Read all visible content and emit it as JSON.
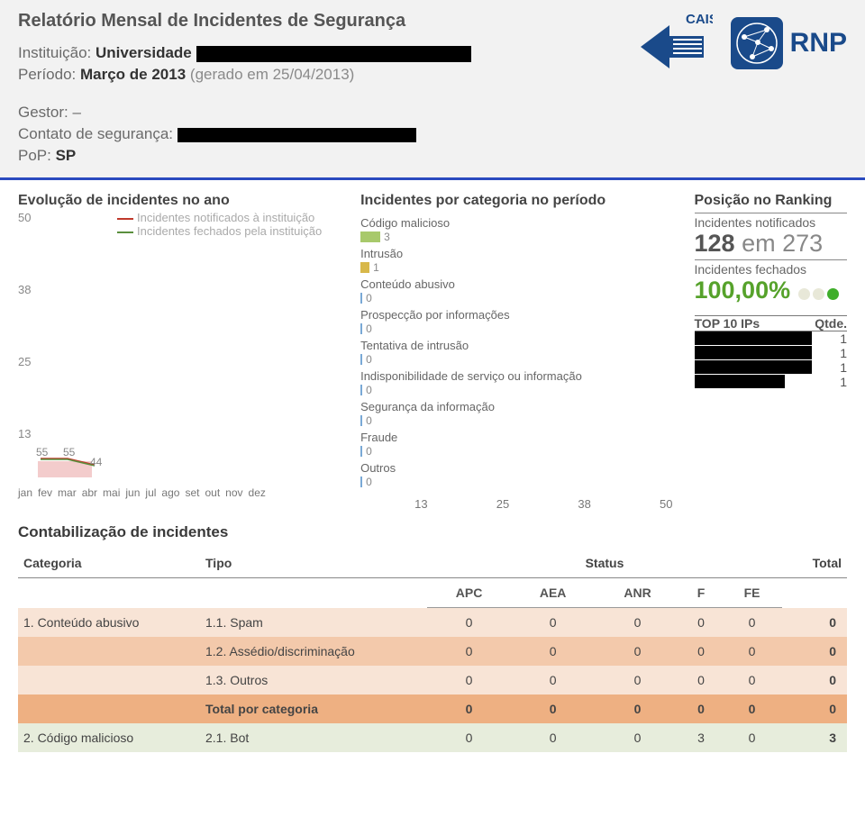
{
  "header": {
    "title": "Relatório Mensal de Incidentes de Segurança",
    "inst_label": "Instituição:",
    "inst_value": "Universidade",
    "periodo_label": "Período:",
    "periodo_value": "Março de 2013",
    "periodo_gen": "(gerado em 25/04/2013)",
    "gestor_label": "Gestor:",
    "gestor_value": "–",
    "contato_label": "Contato de segurança:",
    "pop_label": "PoP:",
    "pop_value": "SP",
    "logo_cais": "CAIS",
    "logo_rnp": "RNP"
  },
  "evo": {
    "title": "Evolução de incidentes no ano",
    "legend_notif": "Incidentes notificados à instituição",
    "legend_fech": "Incidentes fechados pela instituição",
    "y_ticks": [
      "50",
      "38",
      "25",
      "13"
    ],
    "months": [
      "jan",
      "fev",
      "mar",
      "abr",
      "mai",
      "jun",
      "jul",
      "ago",
      "set",
      "out",
      "nov",
      "dez"
    ],
    "labels": [
      "55",
      "55",
      "44"
    ]
  },
  "cat": {
    "title": "Incidentes por categoria no período",
    "items": [
      {
        "name": "Código malicioso",
        "val": "3",
        "w": 22,
        "c": "#a8c96b"
      },
      {
        "name": "Intrusão",
        "val": "1",
        "w": 10,
        "c": "#d8b84a"
      },
      {
        "name": "Conteúdo abusivo",
        "val": "0",
        "w": 2,
        "c": "#7aa9d6"
      },
      {
        "name": "Prospecção por informações",
        "val": "0",
        "w": 2,
        "c": "#7aa9d6"
      },
      {
        "name": "Tentativa de intrusão",
        "val": "0",
        "w": 2,
        "c": "#7aa9d6"
      },
      {
        "name": "Indisponibilidade de serviço ou informação",
        "val": "0",
        "w": 2,
        "c": "#7aa9d6"
      },
      {
        "name": "Segurança da informação",
        "val": "0",
        "w": 2,
        "c": "#7aa9d6"
      },
      {
        "name": "Fraude",
        "val": "0",
        "w": 2,
        "c": "#7aa9d6"
      },
      {
        "name": "Outros",
        "val": "0",
        "w": 2,
        "c": "#7aa9d6"
      }
    ],
    "x_ticks": [
      "13",
      "25",
      "38",
      "50"
    ]
  },
  "rank": {
    "title": "Posição no Ranking",
    "sub1": "Incidentes notificados",
    "pos": "128",
    "sep": "em",
    "tot": "273",
    "sub2": "Incidentes fechados",
    "pct": "100,00%",
    "top10_h": "TOP 10 IPs",
    "top10_q": "Qtde.",
    "rows": [
      {
        "ip": "████████████",
        "q": "1"
      },
      {
        "ip": "████████████",
        "q": "1"
      },
      {
        "ip": "████████████",
        "q": "1"
      },
      {
        "ip": "████████████",
        "q": "1"
      }
    ]
  },
  "tbl": {
    "title": "Contabilização de incidentes",
    "h_cat": "Categoria",
    "h_tipo": "Tipo",
    "h_status": "Status",
    "h_total": "Total",
    "s1": "APC",
    "s2": "AEA",
    "s3": "ANR",
    "s4": "F",
    "s5": "FE",
    "rows": [
      {
        "cls": "r-a",
        "cat": "1. Conteúdo abusivo",
        "tipo": "1.1. Spam",
        "c": [
          "0",
          "0",
          "0",
          "0",
          "0"
        ],
        "t": "0"
      },
      {
        "cls": "r-b",
        "cat": "",
        "tipo": "1.2. Assédio/discriminação",
        "c": [
          "0",
          "0",
          "0",
          "0",
          "0"
        ],
        "t": "0"
      },
      {
        "cls": "r-a",
        "cat": "",
        "tipo": "1.3. Outros",
        "c": [
          "0",
          "0",
          "0",
          "0",
          "0"
        ],
        "t": "0"
      },
      {
        "cls": "r-t",
        "cat": "",
        "tipo": "Total por categoria",
        "c": [
          "0",
          "0",
          "0",
          "0",
          "0"
        ],
        "t": "0"
      },
      {
        "cls": "r-c",
        "cat": "2. Código malicioso",
        "tipo": "2.1. Bot",
        "c": [
          "0",
          "0",
          "0",
          "3",
          "0"
        ],
        "t": "3"
      }
    ]
  },
  "chart_data": [
    {
      "type": "line",
      "title": "Evolução de incidentes no ano",
      "x": [
        "jan",
        "fev",
        "mar",
        "abr",
        "mai",
        "jun",
        "jul",
        "ago",
        "set",
        "out",
        "nov",
        "dez"
      ],
      "series": [
        {
          "name": "Incidentes notificados à instituição",
          "color": "#c0392b",
          "values": [
            5,
            5,
            4,
            null,
            null,
            null,
            null,
            null,
            null,
            null,
            null,
            null
          ]
        },
        {
          "name": "Incidentes fechados pela instituição",
          "color": "#5a8f3d",
          "values": [
            5,
            5,
            4,
            null,
            null,
            null,
            null,
            null,
            null,
            null,
            null,
            null
          ]
        }
      ],
      "ylim": [
        0,
        50
      ],
      "y_ticks": [
        13,
        25,
        38,
        50
      ],
      "point_labels": {
        "jan": "55",
        "fev": "55",
        "mar": "44"
      }
    },
    {
      "type": "bar",
      "orientation": "horizontal",
      "title": "Incidentes por categoria no período",
      "categories": [
        "Código malicioso",
        "Intrusão",
        "Conteúdo abusivo",
        "Prospecção por informações",
        "Tentativa de intrusão",
        "Indisponibilidade de serviço ou informação",
        "Segurança da informação",
        "Fraude",
        "Outros"
      ],
      "values": [
        3,
        1,
        0,
        0,
        0,
        0,
        0,
        0,
        0
      ],
      "xlim": [
        0,
        50
      ],
      "x_ticks": [
        13,
        25,
        38,
        50
      ]
    }
  ]
}
